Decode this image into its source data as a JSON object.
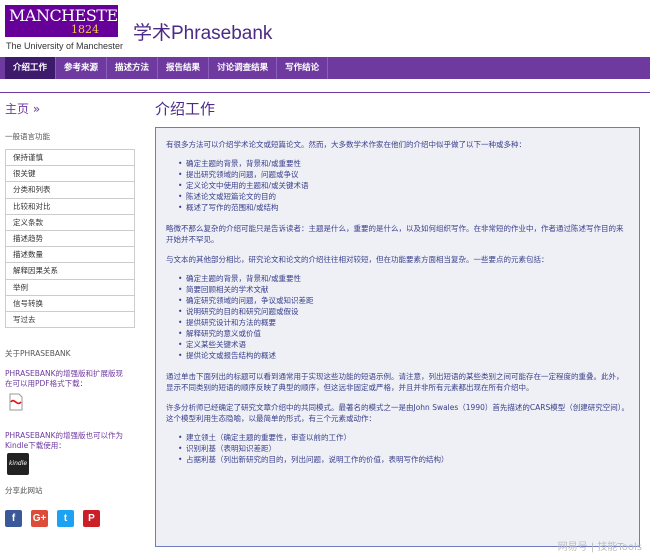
{
  "header": {
    "logo_name": "MANCHESTER",
    "logo_year": "1824",
    "logo_sub": "The University of Manchester",
    "site_title": "学术Phrasebank"
  },
  "nav": {
    "items": [
      "介绍工作",
      "参考来源",
      "描述方法",
      "报告结果",
      "讨论调查结果",
      "写作结论"
    ],
    "active_index": 0
  },
  "sidebar": {
    "home": "主页 »",
    "section_label": "一般语言功能",
    "menu": [
      "保持谨慎",
      "很关键",
      "分类和列表",
      "比较和对比",
      "定义条款",
      "描述趋势",
      "描述数量",
      "解释因果关系",
      "举例",
      "信号转换",
      "写过去"
    ],
    "about_label": "关于PHRASEBANK",
    "pdf_text": "PHRASEBANK的增强版和扩展版现在可以用PDF格式下载：",
    "kindle_text": "PHRASEBANK的增强版也可以作为Kindle下载使用：",
    "kindle_label": "kindle",
    "share_label": "分享此网站",
    "social": [
      {
        "name": "facebook-icon",
        "glyph": "f",
        "color": "#3b5998"
      },
      {
        "name": "google-plus-icon",
        "glyph": "G+",
        "color": "#dd4b39"
      },
      {
        "name": "twitter-icon",
        "glyph": "t",
        "color": "#1da1f2"
      },
      {
        "name": "pinterest-icon",
        "glyph": "P",
        "color": "#cb2027"
      }
    ]
  },
  "main": {
    "title": "介绍工作",
    "para1": "有很多方法可以介绍学术论文或短篇论文。然而，大多数学术作家在他们的介绍中似乎做了以下一种或多种：",
    "list1": [
      "确定主题的背景，背景和/或重要性",
      "提出研究领域的问题，问题或争议",
      "定义论文中使用的主题和/或关键术语",
      "陈述论文或短篇论文的目的",
      "概述了写作的范围和/或结构"
    ],
    "para2": "略微不那么复杂的介绍可能只是告诉读者：主题是什么，重要的是什么，以及如何组织写作。在非常短的作业中，作者通过陈述写作目的来开始并不罕见。",
    "para3": "与文本的其他部分相比，研究论文和论文的介绍往往相对较短，但在功能要素方面相当复杂。一些要点的元素包括：",
    "list2": [
      "确定主题的背景，背景和/或重要性",
      "简要回顾相关的学术文献",
      "确定研究领域的问题，争议或知识差距",
      "说明研究的目的和研究问题或假设",
      "提供研究设计和方法的概要",
      "解释研究的意义或价值",
      "定义某些关键术语",
      "提供论文或报告结构的概述"
    ],
    "para4": "通过单击下面列出的标题可以看到通常用于实现这些功能的短语示例。请注意，列出短语的某些类别之间可能存在一定程度的重叠。此外，显示不同类别的短语的顺序反映了典型的顺序，但这远非固定或严格，并且并非所有元素都出现在所有介绍中。",
    "para5": "许多分析师已经确定了研究文章介绍中的共同模式。最著名的模式之一是由John Swales（1990）首先描述的CARS模型（创建研究空间）。这个模型利用生态隐喻，以最简单的形式，有三个元素或动作：",
    "list3": [
      "建立领土（确定主题的重要性，审查以前的工作）",
      "识别利基（表明知识差距）",
      "占据利基（列出新研究的目的，列出问题，说明工作的价值，表明写作的结构）"
    ]
  },
  "watermark": "网易号 | 技能Tools"
}
